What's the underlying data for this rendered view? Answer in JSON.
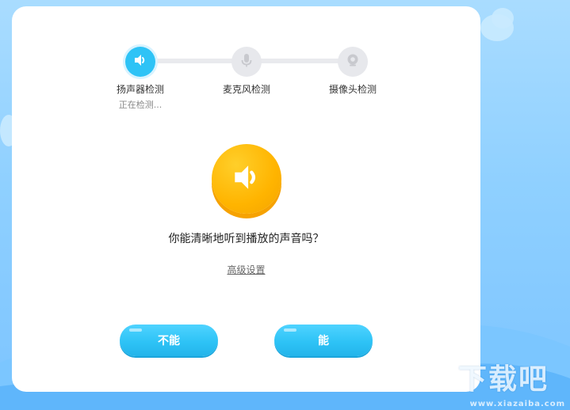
{
  "steps": [
    {
      "label": "扬声器检测",
      "status": "正在检测...",
      "icon": "speaker-icon",
      "state": "active"
    },
    {
      "label": "麦克风检测",
      "icon": "microphone-icon",
      "state": "pending"
    },
    {
      "label": "摄像头检测",
      "icon": "camera-icon",
      "state": "pending"
    }
  ],
  "main": {
    "icon": "speaker-icon",
    "question": "你能清晰地听到播放的声音吗？",
    "advanced_link": "高级设置"
  },
  "buttons": {
    "no": "不能",
    "yes": "能"
  },
  "watermark": {
    "title": "下载吧",
    "url": "www.xiazaiba.com"
  },
  "colors": {
    "accent": "#2ec3f6",
    "speaker_bg": "#ffb400",
    "inactive": "#e7e8ec"
  }
}
